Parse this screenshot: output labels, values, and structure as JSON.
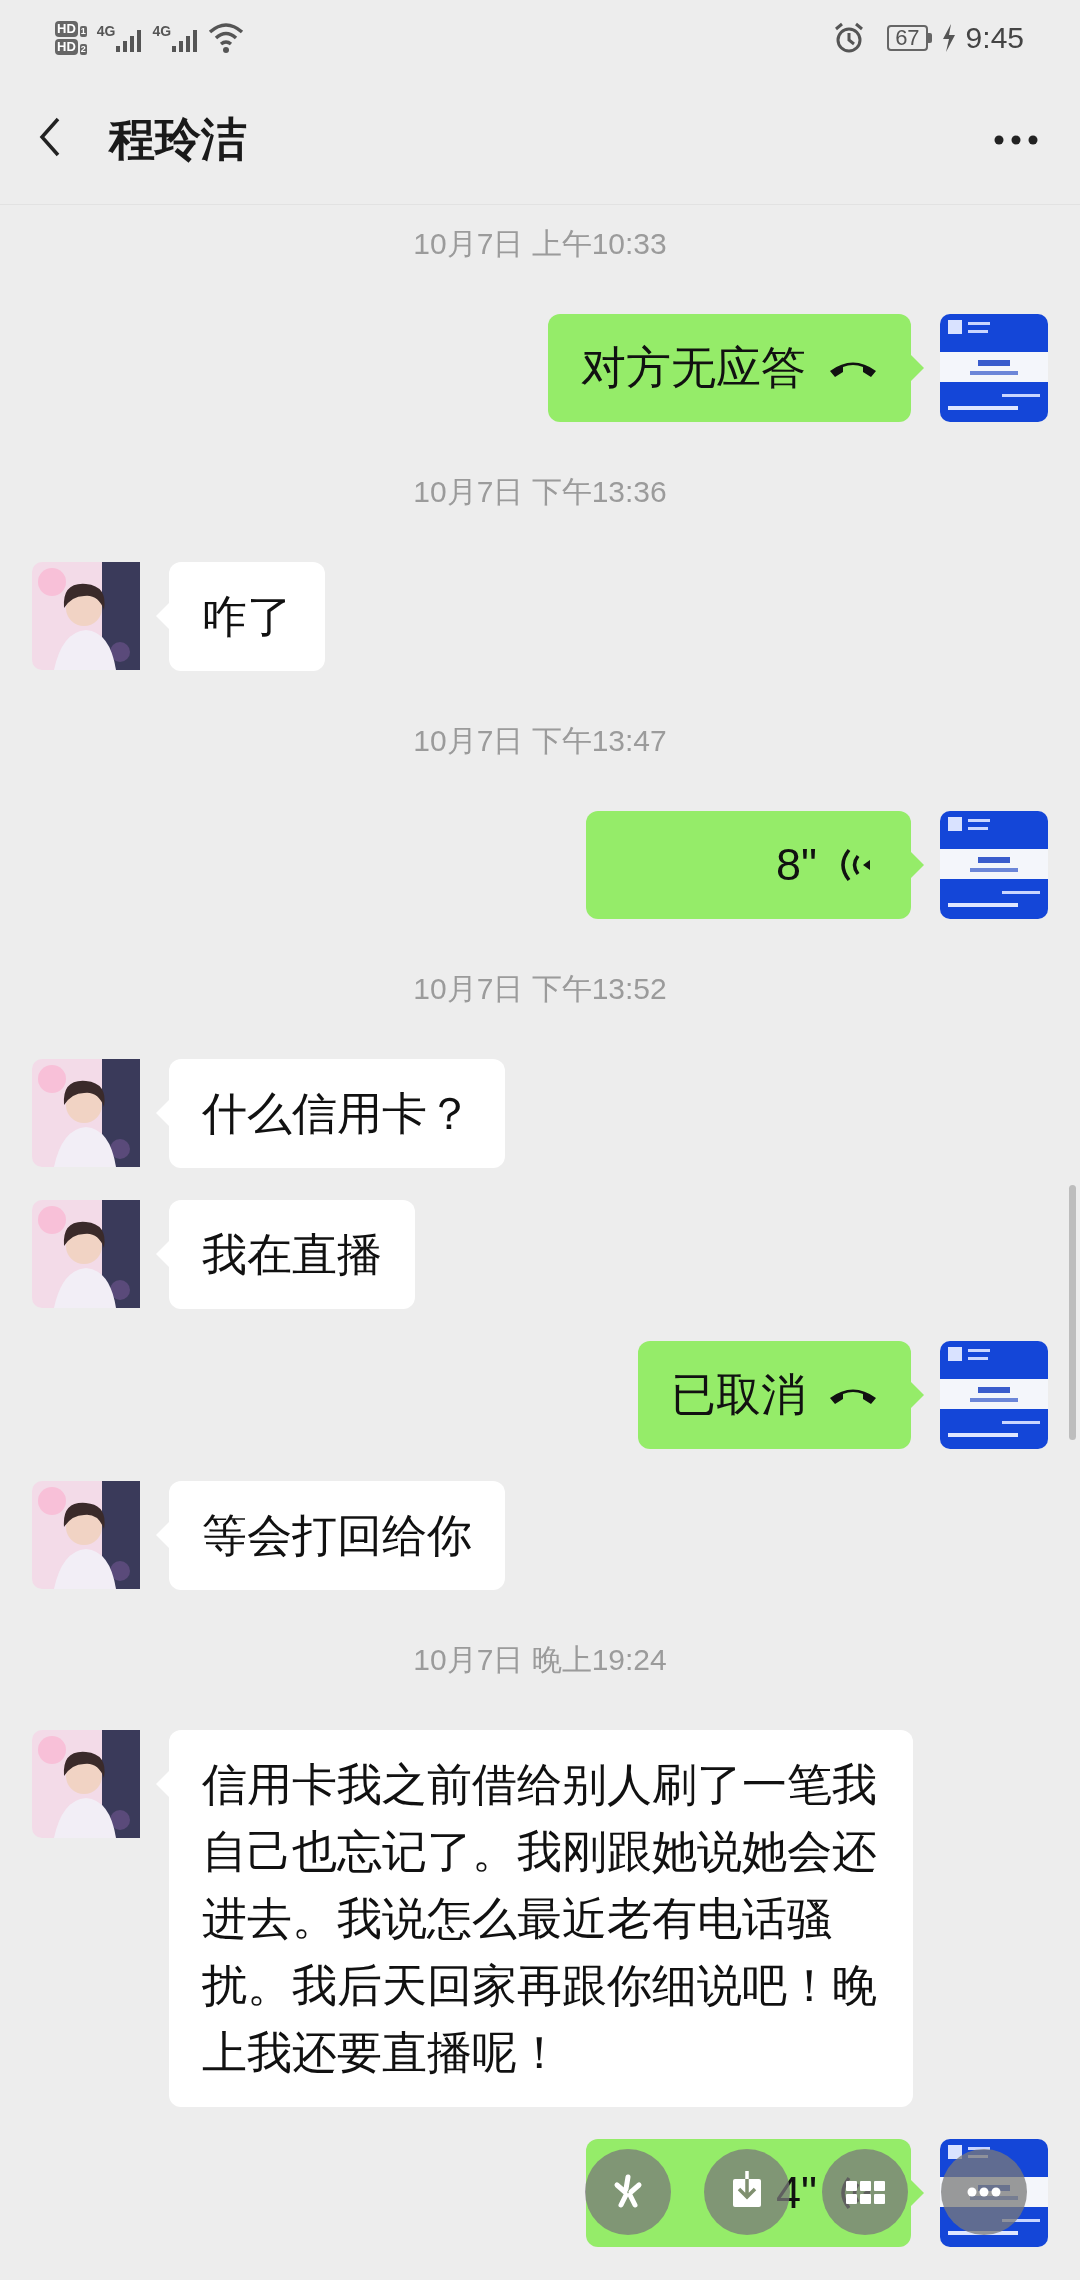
{
  "status_bar": {
    "sims": [
      {
        "label": "HD",
        "slot": "1"
      },
      {
        "label": "HD",
        "slot": "2"
      }
    ],
    "networks": [
      "4G",
      "4G"
    ],
    "battery": "67",
    "charging": true,
    "time": "9:45"
  },
  "header": {
    "title": "程玲洁"
  },
  "messages": [
    {
      "kind": "time",
      "text": "10月7日 上午10:33"
    },
    {
      "kind": "call",
      "outgoing": true,
      "text": "对方无应答"
    },
    {
      "kind": "time",
      "text": "10月7日 下午13:36"
    },
    {
      "kind": "text",
      "outgoing": false,
      "text": "咋了"
    },
    {
      "kind": "time",
      "text": "10月7日 下午13:47"
    },
    {
      "kind": "voice",
      "outgoing": true,
      "text": "8\""
    },
    {
      "kind": "time",
      "text": "10月7日 下午13:52"
    },
    {
      "kind": "text",
      "outgoing": false,
      "text": "什么信用卡？"
    },
    {
      "kind": "text",
      "outgoing": false,
      "text": "我在直播"
    },
    {
      "kind": "call",
      "outgoing": true,
      "text": "已取消"
    },
    {
      "kind": "text",
      "outgoing": false,
      "text": "等会打回给你"
    },
    {
      "kind": "time",
      "text": "10月7日 晚上19:24"
    },
    {
      "kind": "text",
      "outgoing": false,
      "text": "信用卡我之前借给别人刷了一笔我自己也忘记了。我刚跟她说她会还进去。我说怎么最近老有电话骚扰。我后天回家再跟你细说吧！晚上我还要直播呢！"
    },
    {
      "kind": "voice",
      "outgoing": true,
      "text": "4\""
    }
  ]
}
